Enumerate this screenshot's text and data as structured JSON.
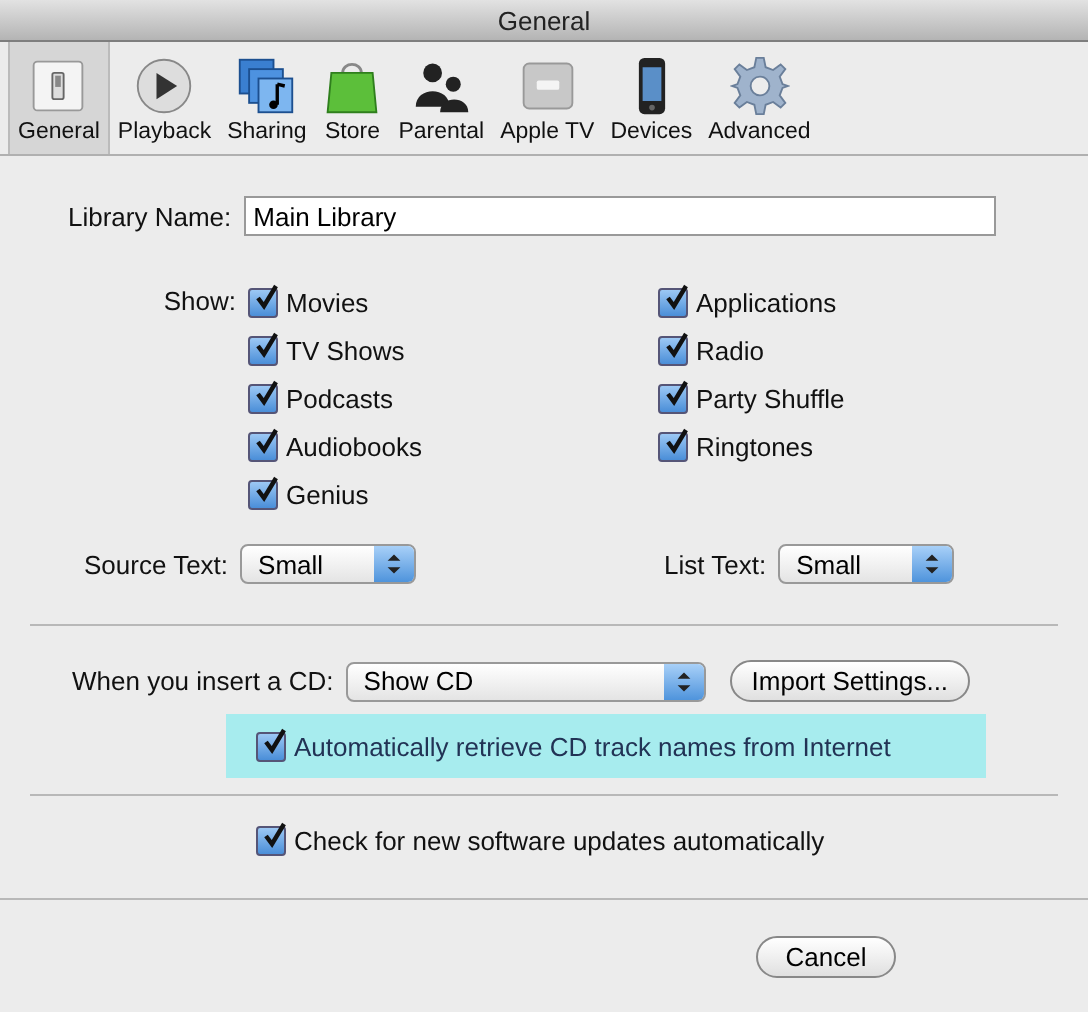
{
  "window": {
    "title": "General"
  },
  "toolbar": [
    {
      "label": "General",
      "selected": true
    },
    {
      "label": "Playback",
      "selected": false
    },
    {
      "label": "Sharing",
      "selected": false
    },
    {
      "label": "Store",
      "selected": false
    },
    {
      "label": "Parental",
      "selected": false
    },
    {
      "label": "Apple TV",
      "selected": false
    },
    {
      "label": "Devices",
      "selected": false
    },
    {
      "label": "Advanced",
      "selected": false
    }
  ],
  "library_name": {
    "label": "Library Name:",
    "value": "Main Library"
  },
  "show": {
    "label": "Show:",
    "columns": [
      [
        {
          "label": "Movies",
          "checked": true
        },
        {
          "label": "TV Shows",
          "checked": true
        },
        {
          "label": "Podcasts",
          "checked": true
        },
        {
          "label": "Audiobooks",
          "checked": true
        },
        {
          "label": "Genius",
          "checked": true
        }
      ],
      [
        {
          "label": "Applications",
          "checked": true
        },
        {
          "label": "Radio",
          "checked": true
        },
        {
          "label": "Party Shuffle",
          "checked": true
        },
        {
          "label": "Ringtones",
          "checked": true
        }
      ]
    ]
  },
  "source_text": {
    "label": "Source Text:",
    "value": "Small"
  },
  "list_text": {
    "label": "List Text:",
    "value": "Small"
  },
  "cd": {
    "label": "When you insert a CD:",
    "value": "Show CD",
    "button": "Import Settings...",
    "auto_retrieve": {
      "label": "Automatically retrieve CD track names from Internet",
      "checked": true,
      "highlighted": true
    }
  },
  "updates": {
    "label": "Check for new software updates automatically",
    "checked": true
  },
  "buttons": [
    "Cancel"
  ]
}
